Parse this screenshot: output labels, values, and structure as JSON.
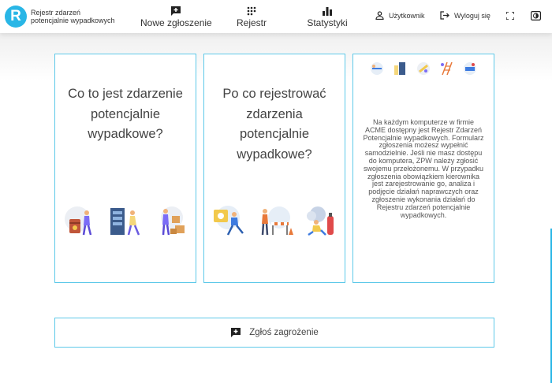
{
  "app": {
    "logo_letter": "R",
    "title_line1": "Rejestr zdarzeń",
    "title_line2": "potencjalnie wypadkowych"
  },
  "nav": {
    "new_report": "Nowe zgłoszenie",
    "registry": "Rejestr",
    "statistics": "Statystyki"
  },
  "header_right": {
    "users": "Użytkownik",
    "logout": "Wyloguj się"
  },
  "cards": [
    {
      "title": "Co to jest zdarzenie potencjalnie wypadkowe?"
    },
    {
      "title": "Po co rejestrować zdarzenia potencjalnie wypadkowe?"
    },
    {
      "text": "Na każdym komputerze w firmie ACME dostępny jest Rejestr Zdarzeń Potencjalnie wypadkowych. Formularz zgłoszenia możesz wypełnić samodzielnie. Jeśli nie masz dostępu do komputera, ZPW należy zgłosić swojemu przełożonemu. W przypadku zgłoszenia obowiązkiem kierownika jest zarejestrowanie go, analiza i podjęcie działań naprawczych oraz zgłoszenie wykonania działań do Rejestru zdarzeń potencjalnie wypadkowych."
    }
  ],
  "actions": {
    "report_hazard": "Zgłoś zagrożenie"
  },
  "colors": {
    "accent": "#29b6e6",
    "card_border": "#5ec9e9"
  }
}
